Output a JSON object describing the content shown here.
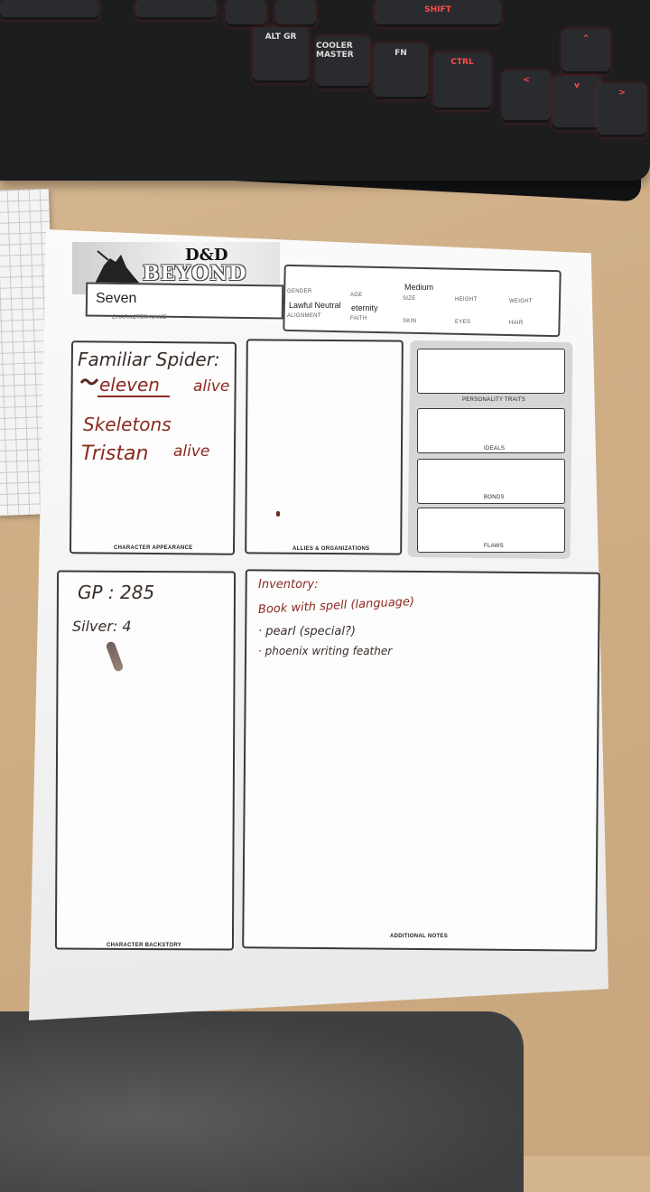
{
  "keyboard": {
    "keys": [
      "SHIFT",
      "ALT GR",
      "COOLER MASTER",
      "FN",
      "CTRL",
      "^",
      "<",
      "v",
      ">"
    ]
  },
  "sheet": {
    "logo": {
      "dd": "D&D",
      "beyond": "BEYOND"
    },
    "character_name": {
      "value": "Seven",
      "label": "CHARACTER NAME"
    },
    "info": {
      "gender_label": "GENDER",
      "age_label": "AGE",
      "age_value": "eternity",
      "size_label": "SIZE",
      "size_value": "Medium",
      "height_label": "HEIGHT",
      "weight_label": "WEIGHT",
      "alignment_label": "ALIGNMENT",
      "alignment_value": "Lawful Neutral",
      "faith_label": "FAITH",
      "skin_label": "SKIN",
      "eyes_label": "EYES",
      "hair_label": "HAIR"
    },
    "panels": {
      "appearance": "CHARACTER APPEARANCE",
      "allies": "ALLIES & ORGANIZATIONS",
      "personality": "PERSONALITY TRAITS",
      "ideals": "IDEALS",
      "bonds": "BONDS",
      "flaws": "FLAWS",
      "backstory": "CHARACTER BACKSTORY",
      "notes": "ADDITIONAL NOTES"
    },
    "handwriting": {
      "appearance": {
        "line1": "Familiar Spider:",
        "line2_word": "eleven",
        "line2_status": "alive",
        "line3": "Skeletons",
        "line4_name": "Tristan",
        "line4_status": "alive"
      },
      "backstory": {
        "gp": "GP : 285",
        "silver": "Silver: 4"
      },
      "notes": {
        "heading": "Inventory:",
        "item1": "Book with spell (language)",
        "item2": "· pearl (special?)",
        "item3": "· phoenix writing feather"
      }
    }
  },
  "colors": {
    "ink_red": "#8a2a1f",
    "ink_dark": "#3a2e2a",
    "key_accent": "#ff4b4b"
  }
}
